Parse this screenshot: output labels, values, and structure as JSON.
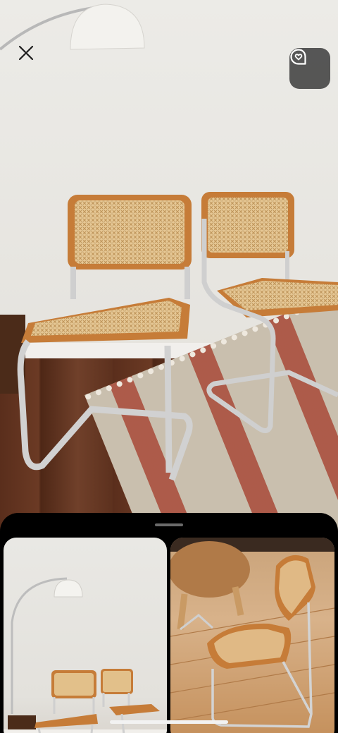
{
  "controls": {
    "close_icon": "close-icon",
    "lens_icon": "visual-lookup-icon"
  },
  "results": [
    {
      "icon": "image-thumbnail"
    },
    {
      "icon": "image-thumbnail"
    }
  ],
  "colors": {
    "chrome": "#000000",
    "lens_button_bg": "#3c3c3c",
    "cane": "#d9b27a",
    "wood_frame": "#c77f3d",
    "chrome_tube": "#c9c9c9",
    "floor": "#5a2e1c"
  }
}
